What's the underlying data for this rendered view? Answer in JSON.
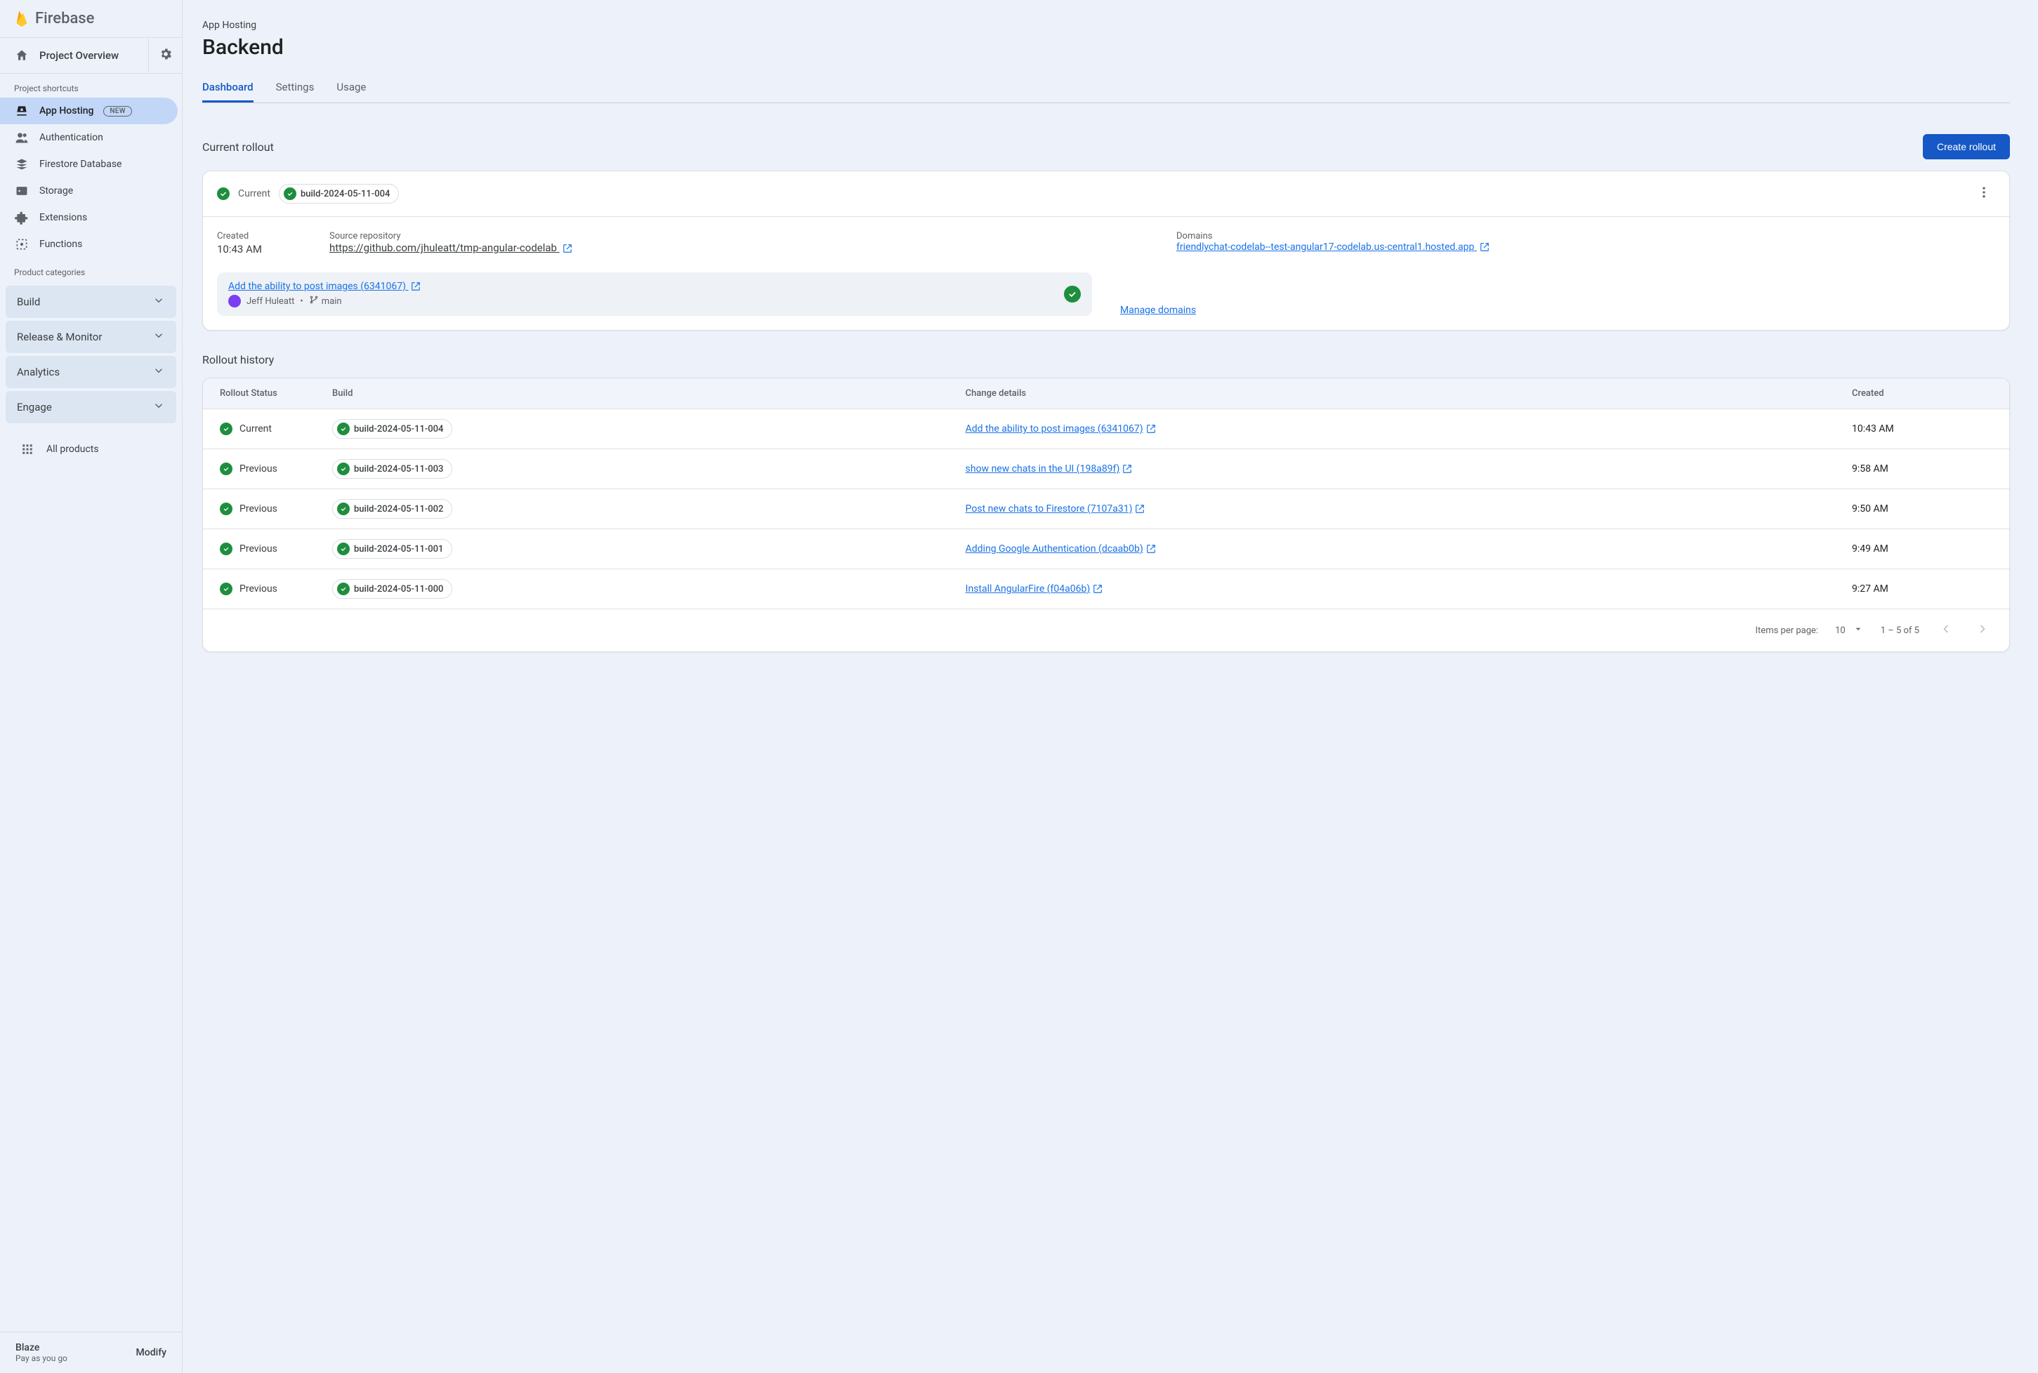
{
  "brand": "Firebase",
  "project_overview_label": "Project Overview",
  "sidebar": {
    "shortcuts_label": "Project shortcuts",
    "items": [
      {
        "label": "App Hosting",
        "badge": "NEW",
        "active": true
      },
      {
        "label": "Authentication",
        "badge": null,
        "active": false
      },
      {
        "label": "Firestore Database",
        "badge": null,
        "active": false
      },
      {
        "label": "Storage",
        "badge": null,
        "active": false
      },
      {
        "label": "Extensions",
        "badge": null,
        "active": false
      },
      {
        "label": "Functions",
        "badge": null,
        "active": false
      }
    ],
    "categories_label": "Product categories",
    "categories": [
      {
        "label": "Build"
      },
      {
        "label": "Release & Monitor"
      },
      {
        "label": "Analytics"
      },
      {
        "label": "Engage"
      }
    ],
    "all_products_label": "All products",
    "plan": {
      "name": "Blaze",
      "subtitle": "Pay as you go",
      "modify": "Modify"
    }
  },
  "header": {
    "breadcrumb": "App Hosting",
    "title": "Backend",
    "tabs": [
      {
        "label": "Dashboard",
        "active": true
      },
      {
        "label": "Settings",
        "active": false
      },
      {
        "label": "Usage",
        "active": false
      }
    ]
  },
  "current_rollout": {
    "section_label": "Current rollout",
    "create_button": "Create rollout",
    "status_label": "Current",
    "build_chip": "build-2024-05-11-004",
    "created_label": "Created",
    "created_value": "10:43 AM",
    "repo_label": "Source repository",
    "repo_url": "https://github.com/jhuleatt/tmp-angular-codelab",
    "domains_label": "Domains",
    "domain_url": "friendlychat-codelab--test-angular17-codelab.us-central1.hosted.app",
    "commit": {
      "title": "Add the ability to post images (6341067)",
      "author": "Jeff Huleatt",
      "branch": "main"
    },
    "manage_domains_label": "Manage domains"
  },
  "history": {
    "title": "Rollout history",
    "columns": [
      "Rollout Status",
      "Build",
      "Change details",
      "Created"
    ],
    "rows": [
      {
        "status": "Current",
        "build": "build-2024-05-11-004",
        "change": "Add the ability to post images (6341067)",
        "created": "10:43 AM"
      },
      {
        "status": "Previous",
        "build": "build-2024-05-11-003",
        "change": "show new chats in the UI (198a89f)",
        "created": "9:58 AM"
      },
      {
        "status": "Previous",
        "build": "build-2024-05-11-002",
        "change": "Post new chats to Firestore (7107a31)",
        "created": "9:50 AM"
      },
      {
        "status": "Previous",
        "build": "build-2024-05-11-001",
        "change": "Adding Google Authentication (dcaab0b)",
        "created": "9:49 AM"
      },
      {
        "status": "Previous",
        "build": "build-2024-05-11-000",
        "change": "Install AngularFire (f04a06b)",
        "created": "9:27 AM"
      }
    ],
    "footer": {
      "items_per_page_label": "Items per page:",
      "page_size": "10",
      "range": "1 – 5 of 5"
    }
  }
}
